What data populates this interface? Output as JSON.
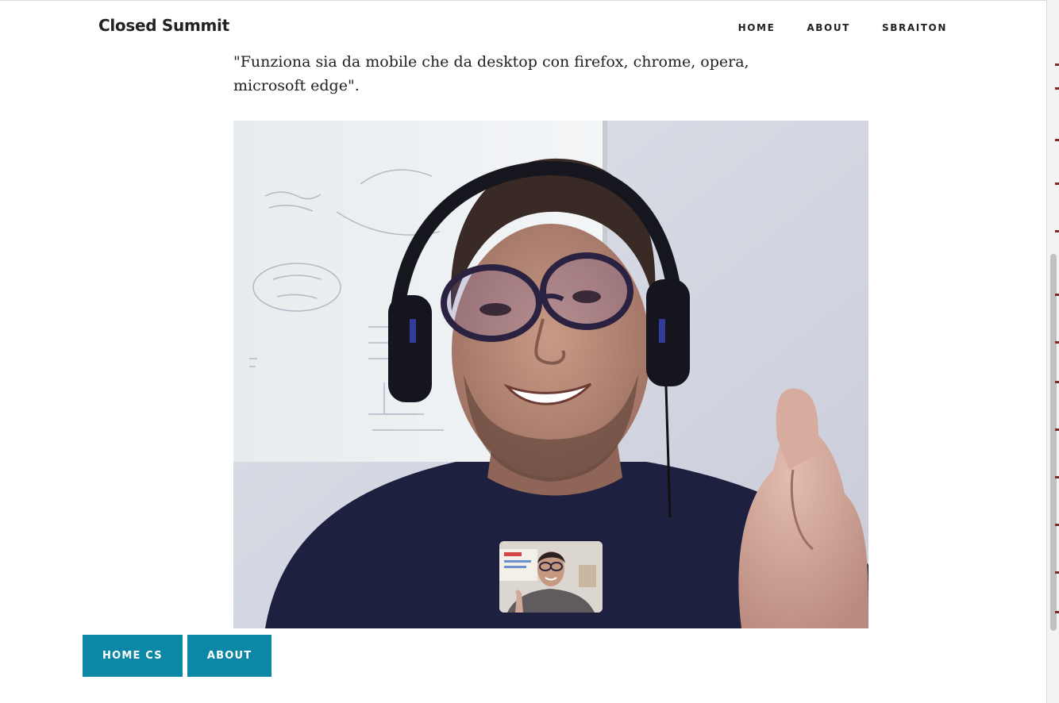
{
  "header": {
    "site_title": "Closed Summit",
    "nav": [
      "HOME",
      "ABOUT",
      "SBRAITON"
    ]
  },
  "article": {
    "quote": "\"Funziona sia da mobile che da desktop con firefox, chrome, opera, microsoft edge\"."
  },
  "footer_buttons": [
    "HOME CS",
    "ABOUT"
  ],
  "colors": {
    "button_bg": "#0c87a5",
    "title_text": "#222222"
  }
}
